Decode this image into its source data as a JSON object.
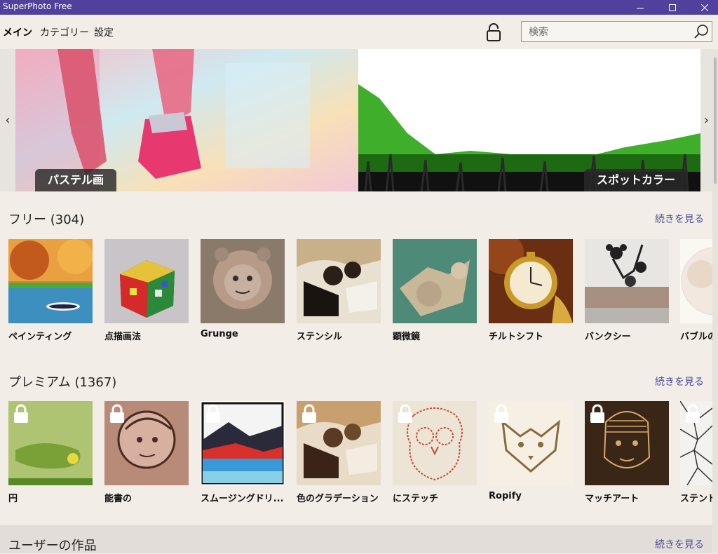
{
  "window": {
    "title": "SuperPhoto Free"
  },
  "nav": {
    "items": [
      "メイン",
      "カテゴリー",
      "設定"
    ]
  },
  "search": {
    "placeholder": "検索"
  },
  "hero": {
    "banner1_label": "パステル画",
    "banner2_label": "スポットカラー"
  },
  "free": {
    "title": "フリー (304)",
    "more": "続きを見る",
    "tiles": [
      "ペインティング",
      "点描画法",
      "Grunge",
      "ステンシル",
      "顕微鏡",
      "チルトシフト",
      "バンクシー",
      "バブルの"
    ]
  },
  "premium": {
    "title": "プレミアム (1367)",
    "more": "続きを見る",
    "tiles": [
      "円",
      "能書の",
      "スムージングドリ...",
      "色のグラデーション",
      "にステッチ",
      "Ropify",
      "マッチアート",
      "ステンド"
    ]
  },
  "user_works": {
    "title": "ユーザーの作品",
    "more": "続きを見る"
  },
  "colors": {
    "titlebar": "#51409c",
    "background": "#f2ede6",
    "link": "#4f4c9a"
  }
}
